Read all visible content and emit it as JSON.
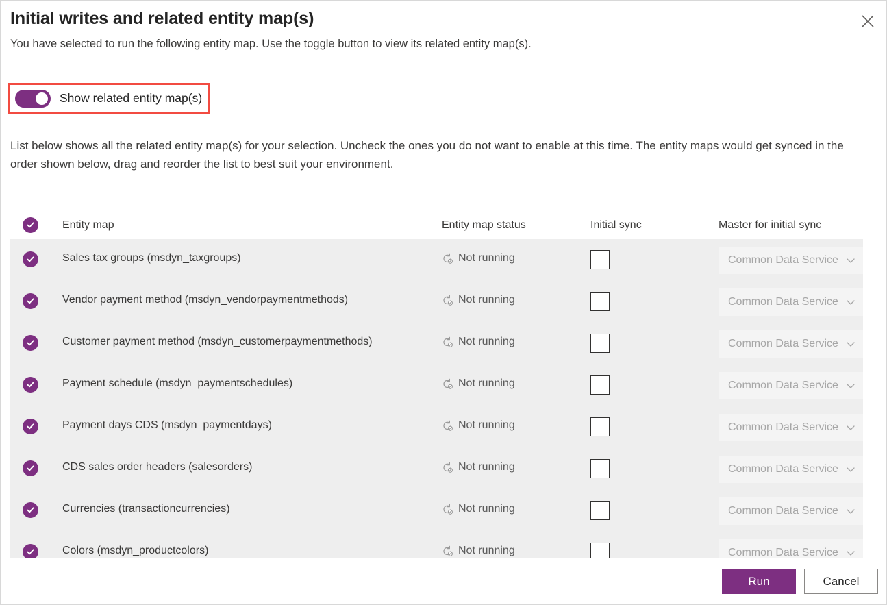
{
  "dialog": {
    "title": "Initial writes and related entity map(s)",
    "subtitle": "You have selected to run the following entity map. Use the toggle button to view its related entity map(s).",
    "close_icon": "close-icon",
    "list_description": "List below shows all the related entity map(s) for your selection. Uncheck the ones you do not want to enable at this time. The entity maps would get synced in the order shown below, drag and reorder the list to best suit your environment."
  },
  "toggle": {
    "label": "Show related entity map(s)",
    "checked": true,
    "accent_color": "#7d2f81",
    "callout_color": "#f24b41"
  },
  "table": {
    "headers": {
      "select_all": "select-all-check-icon",
      "entity_map": "Entity map",
      "entity_map_status": "Entity map status",
      "initial_sync": "Initial sync",
      "master_for_initial_sync": "Master for initial sync"
    },
    "rows": [
      {
        "checked": true,
        "name": "Sales tax groups (msdyn_taxgroups)",
        "status": "Not running",
        "status_icon": "sync-not-running-icon",
        "initial_sync_checked": false,
        "master": "Common Data Service"
      },
      {
        "checked": true,
        "name": "Vendor payment method (msdyn_vendorpaymentmethods)",
        "status": "Not running",
        "status_icon": "sync-not-running-icon",
        "initial_sync_checked": false,
        "master": "Common Data Service"
      },
      {
        "checked": true,
        "name": "Customer payment method (msdyn_customerpaymentmethods)",
        "status": "Not running",
        "status_icon": "sync-not-running-icon",
        "initial_sync_checked": false,
        "master": "Common Data Service"
      },
      {
        "checked": true,
        "name": "Payment schedule (msdyn_paymentschedules)",
        "status": "Not running",
        "status_icon": "sync-not-running-icon",
        "initial_sync_checked": false,
        "master": "Common Data Service"
      },
      {
        "checked": true,
        "name": "Payment days CDS (msdyn_paymentdays)",
        "status": "Not running",
        "status_icon": "sync-not-running-icon",
        "initial_sync_checked": false,
        "master": "Common Data Service"
      },
      {
        "checked": true,
        "name": "CDS sales order headers (salesorders)",
        "status": "Not running",
        "status_icon": "sync-not-running-icon",
        "initial_sync_checked": false,
        "master": "Common Data Service"
      },
      {
        "checked": true,
        "name": "Currencies (transactioncurrencies)",
        "status": "Not running",
        "status_icon": "sync-not-running-icon",
        "initial_sync_checked": false,
        "master": "Common Data Service"
      },
      {
        "checked": true,
        "name": "Colors (msdyn_productcolors)",
        "status": "Not running",
        "status_icon": "sync-not-running-icon",
        "initial_sync_checked": false,
        "master": "Common Data Service"
      }
    ]
  },
  "footer": {
    "run_label": "Run",
    "cancel_label": "Cancel",
    "primary_color": "#7d2f81"
  }
}
